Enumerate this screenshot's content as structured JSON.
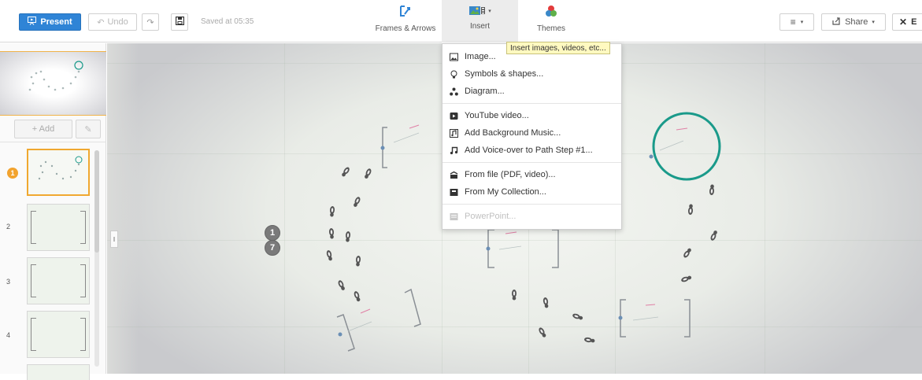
{
  "toolbar": {
    "present_label": "Present",
    "undo_label": "Undo",
    "saved_text": "Saved at 05:35",
    "frames_label": "Frames & Arrows",
    "insert_label": "Insert",
    "themes_label": "Themes",
    "share_label": "Share",
    "exit_label": "E"
  },
  "tooltip": "Insert images, videos, etc...",
  "sidebar": {
    "add_label": "+ Add",
    "slides": [
      {
        "num": "1",
        "active": true
      },
      {
        "num": "2",
        "active": false
      },
      {
        "num": "3",
        "active": false
      },
      {
        "num": "4",
        "active": false
      }
    ]
  },
  "canvas": {
    "path_steps": [
      "1",
      "7"
    ]
  },
  "insert_menu": {
    "items": [
      {
        "label": "Image...",
        "icon": "image-icon"
      },
      {
        "label": "Symbols & shapes...",
        "icon": "lightbulb-icon"
      },
      {
        "label": "Diagram...",
        "icon": "diagram-icon"
      },
      {
        "label": "YouTube video...",
        "icon": "youtube-icon"
      },
      {
        "label": "Add Background Music...",
        "icon": "music-file-icon"
      },
      {
        "label": "Add Voice-over to Path Step #1...",
        "icon": "music-note-icon"
      },
      {
        "label": "From file (PDF, video)...",
        "icon": "file-import-icon"
      },
      {
        "label": "From My Collection...",
        "icon": "collection-icon"
      },
      {
        "label": "PowerPoint...",
        "icon": "powerpoint-icon",
        "disabled": true
      }
    ]
  },
  "colors": {
    "present_blue": "#2f84d6",
    "active_slide_orange": "#f0a830",
    "circle_teal": "#1a9a8a",
    "tooltip_yellow": "#fff9c0"
  }
}
